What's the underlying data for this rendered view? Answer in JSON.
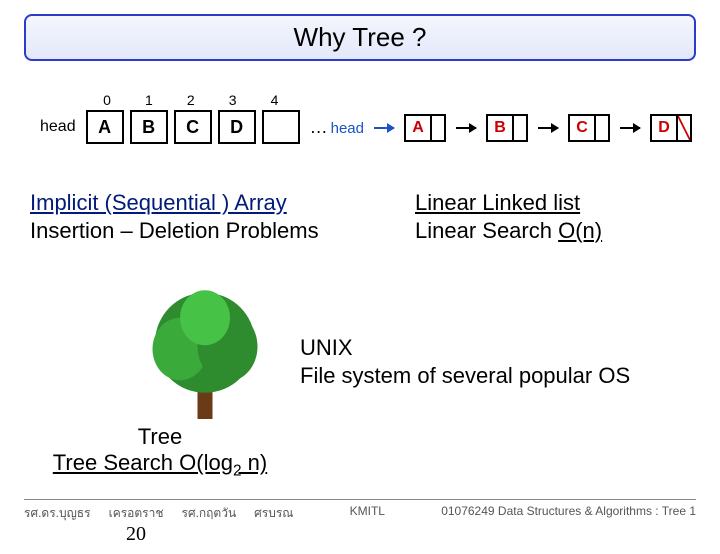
{
  "title": "Why Tree ?",
  "array": {
    "head_label": "head",
    "indices": [
      "0",
      "1",
      "2",
      "3",
      "4"
    ],
    "cells": [
      "A",
      "B",
      "C",
      "D"
    ],
    "dots": "…"
  },
  "linked_list": {
    "head_label": "head",
    "nodes": [
      "A",
      "B",
      "C",
      "D"
    ]
  },
  "caption_array": {
    "line1": "Implicit (Sequential ) Array",
    "line2": "Insertion – Deletion Problems"
  },
  "caption_linked": {
    "line1": "Linear Linked list",
    "line2_pre": "Linear Search ",
    "line2_u": "O(n)"
  },
  "unix": {
    "line1": "UNIX",
    "line2": "File system of several popular OS"
  },
  "tree_caption": {
    "line1": "Tree",
    "line2_pre": "Tree Search O(log",
    "line2_sub": "2",
    "line2_post": " n)"
  },
  "footer": {
    "author1a": "รศ.ดร.บุญธร",
    "author1b": "เครอตราช",
    "author2a": "รศ.กฤตวัน",
    "author2b": "ศรบรณ",
    "inst": "KMITL",
    "course": "01076249 Data Structures & Algorithms : Tree 1",
    "page": "20"
  }
}
